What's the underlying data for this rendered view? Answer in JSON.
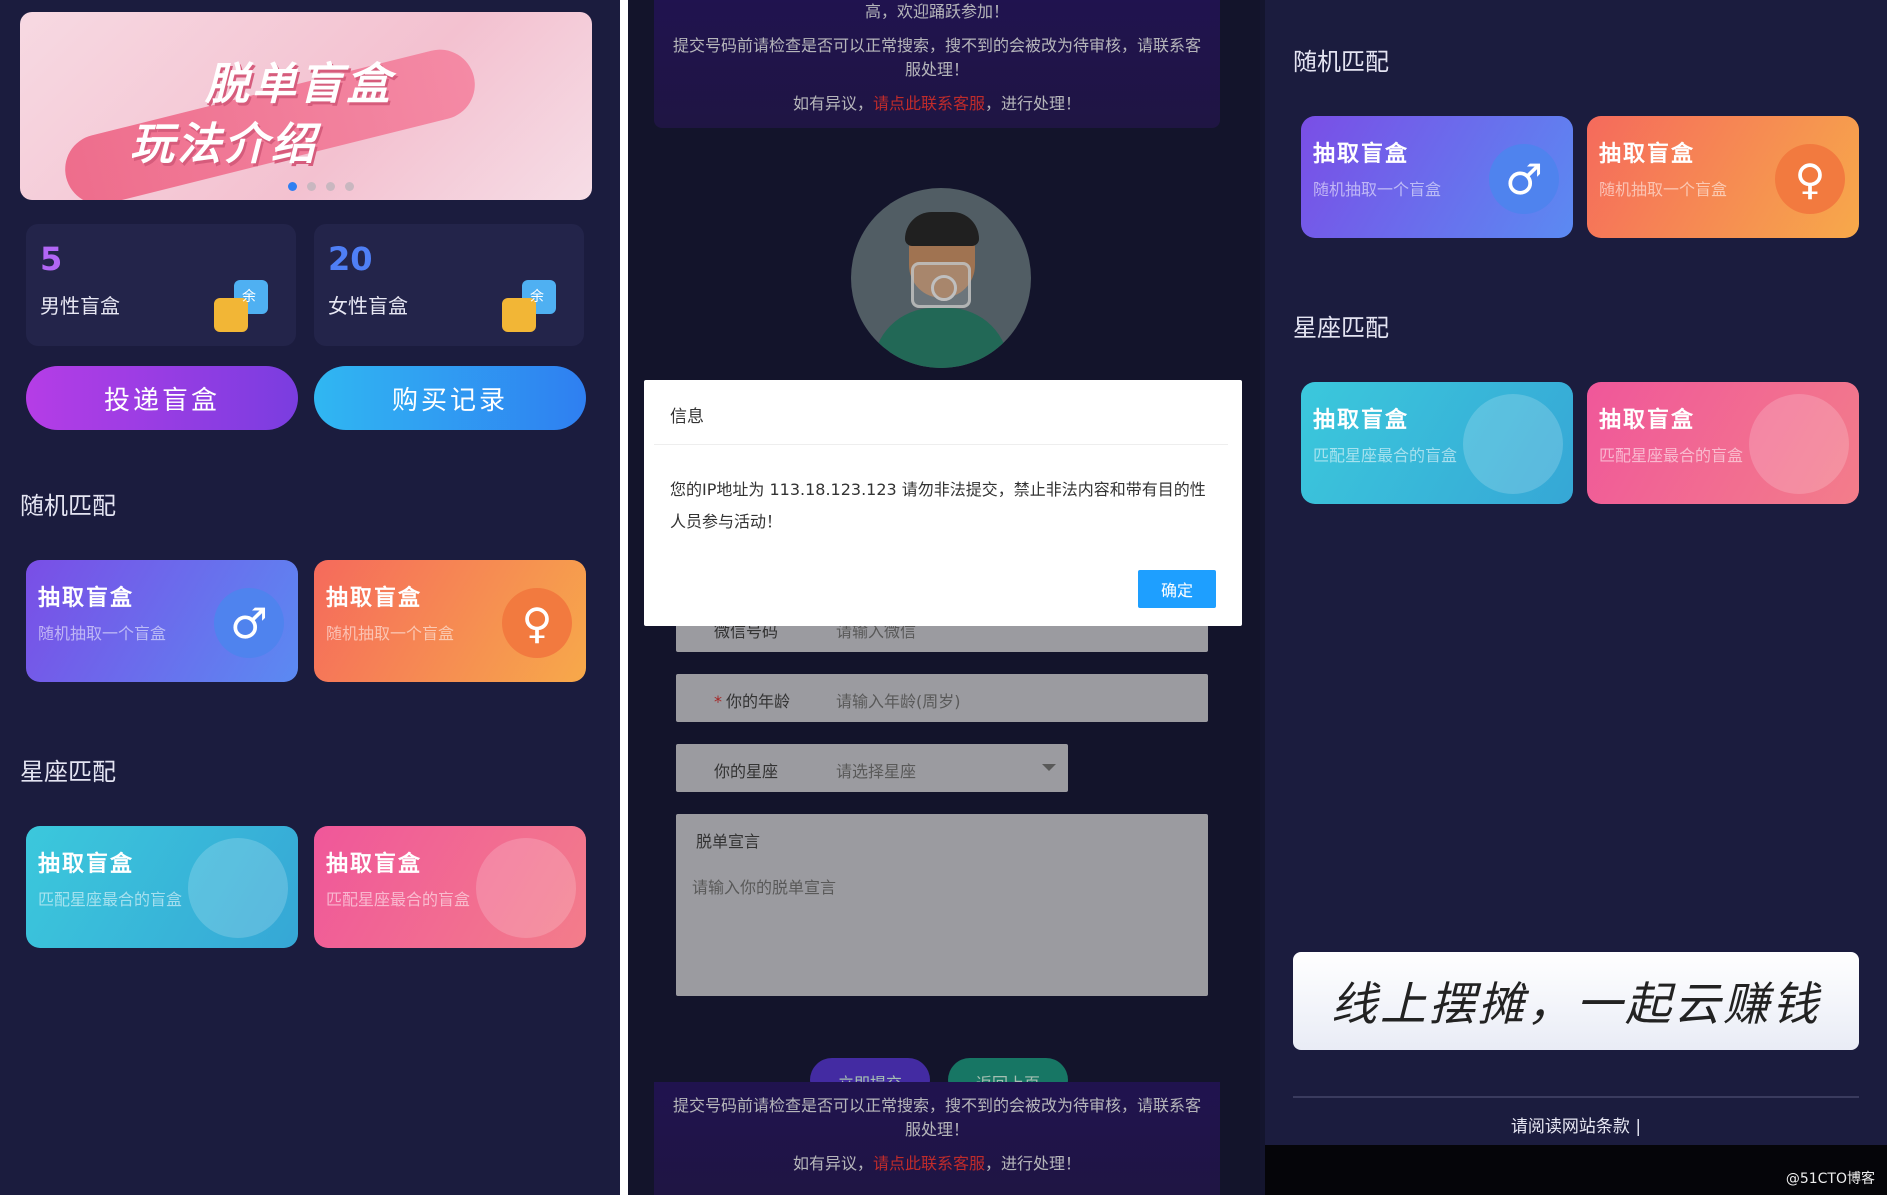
{
  "panel_left": {
    "banner": {
      "title_line1": "脱单盲盒",
      "title_line2": "玩法介绍",
      "active_dot": 1,
      "dot_count": 4
    },
    "stats": [
      {
        "value": "5",
        "label": "男性盲盒",
        "badge": "余"
      },
      {
        "value": "20",
        "label": "女性盲盒",
        "badge": "余"
      }
    ],
    "buttons": {
      "deliver": "投递盲盒",
      "purchase_record": "购买记录"
    },
    "random_title": "随机匹配",
    "random_cards": [
      {
        "title": "抽取盲盒",
        "subtitle": "随机抽取一个盲盒",
        "icon": "male-symbol-icon",
        "symbol": "♂"
      },
      {
        "title": "抽取盲盒",
        "subtitle": "随机抽取一个盲盒",
        "icon": "female-symbol-icon",
        "symbol": "♀"
      }
    ],
    "zodiac_title": "星座匹配",
    "zodiac_cards": [
      {
        "title": "抽取盲盒",
        "subtitle": "匹配星座最合的盲盒",
        "icon": "zodiac-warrior-icon"
      },
      {
        "title": "抽取盲盒",
        "subtitle": "匹配星座最合的盲盒",
        "icon": "zodiac-maiden-icon"
      }
    ]
  },
  "panel_middle": {
    "notice_top": {
      "line0": "高，欢迎踊跃参加！",
      "line1": "提交号码前请检查是否可以正常搜索，搜不到的会被改为待审核，请联系客服处理！",
      "line2_prefix": "如有异议，",
      "line2_link": "请点此联系客服",
      "line2_suffix": "，进行处理！"
    },
    "form": {
      "wechat_label": "微信号码",
      "wechat_placeholder": "请输入微信",
      "age_label": "你的年龄",
      "age_placeholder": "请输入年龄(周岁)",
      "zodiac_label": "你的星座",
      "zodiac_placeholder": "请选择星座",
      "declaration_label": "脱单宣言",
      "declaration_placeholder": "请输入你的脱单宣言"
    },
    "mini_buttons": {
      "submit": "立即提交",
      "back": "返回上页"
    },
    "notice_bottom": {
      "line1": "提交号码前请检查是否可以正常搜索，搜不到的会被改为待审核，请联系客服处理！",
      "line2_prefix": "如有异议，",
      "line2_link": "请点此联系客服",
      "line2_suffix": "，进行处理！"
    },
    "dialog": {
      "title": "信息",
      "message": "您的IP地址为 113.18.123.123 请勿非法提交，禁止非法内容和带有目的性人员参与活动！",
      "confirm": "确定"
    }
  },
  "panel_right": {
    "random_title": "随机匹配",
    "zodiac_title": "星座匹配",
    "slogan": "线上摆摊，一起云赚钱",
    "footer_link": "请阅读网站条款 |",
    "watermark": "@51CTO博客"
  },
  "colors": {
    "background": "#1b1c3e",
    "accent_blue": "#1e9fff",
    "purple_btn": "#9b3fe0",
    "blue_btn": "#2aa8f0",
    "male_card": "#6a6ef0",
    "female_card": "#f5883f",
    "zodiac_cyan": "#36c3da",
    "zodiac_pink": "#f05a93",
    "link_red": "#ff3a3a"
  }
}
